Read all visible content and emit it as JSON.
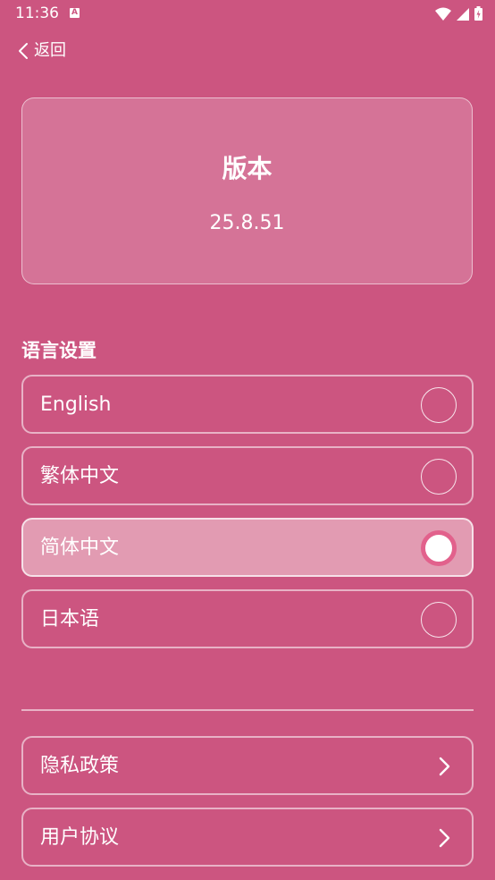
{
  "status_bar": {
    "time": "11:36",
    "notification_letter": "A",
    "icons": [
      "wifi-icon",
      "signal-icon",
      "battery-icon"
    ]
  },
  "header": {
    "back_label": "返回"
  },
  "version_card": {
    "title": "版本",
    "number": "25.8.51"
  },
  "language_section": {
    "title": "语言设置",
    "options": [
      {
        "label": "English",
        "selected": false
      },
      {
        "label": "繁体中文",
        "selected": false
      },
      {
        "label": "简体中文",
        "selected": true
      },
      {
        "label": "日本语",
        "selected": false
      }
    ]
  },
  "links": [
    {
      "label": "隐私政策"
    },
    {
      "label": "用户协议"
    }
  ],
  "colors": {
    "background": "#cc5580",
    "selected_background": "#e29bb2",
    "radio_ring": "#e2618c",
    "text": "#ffffff"
  }
}
